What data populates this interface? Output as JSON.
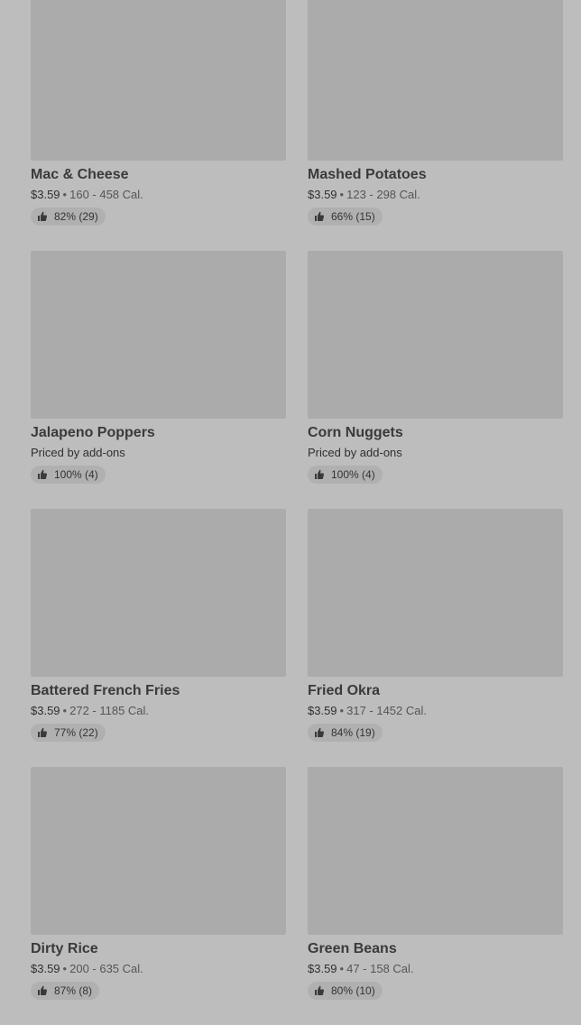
{
  "items": [
    {
      "name": "Mac & Cheese",
      "price": "$3.59",
      "separator": "•",
      "calories": "160 - 458 Cal.",
      "rating": "82% (29)",
      "icon": "thumbs-up-icon"
    },
    {
      "name": "Mashed Potatoes",
      "price": "$3.59",
      "separator": "•",
      "calories": "123 - 298 Cal.",
      "rating": "66% (15)",
      "icon": "thumbs-up-icon"
    },
    {
      "name": "Jalapeno Poppers",
      "price": "Priced by add-ons",
      "separator": "",
      "calories": "",
      "rating": "100% (4)",
      "icon": "thumbs-up-icon"
    },
    {
      "name": "Corn Nuggets",
      "price": "Priced by add-ons",
      "separator": "",
      "calories": "",
      "rating": "100% (4)",
      "icon": "thumbs-up-icon"
    },
    {
      "name": "Battered French Fries",
      "price": "$3.59",
      "separator": "•",
      "calories": "272 - 1185 Cal.",
      "rating": "77% (22)",
      "icon": "thumbs-up-icon"
    },
    {
      "name": "Fried Okra",
      "price": "$3.59",
      "separator": "•",
      "calories": "317 - 1452 Cal.",
      "rating": "84% (19)",
      "icon": "thumbs-up-icon"
    },
    {
      "name": "Dirty Rice",
      "price": "$3.59",
      "separator": "•",
      "calories": "200 - 635 Cal.",
      "rating": "87% (8)",
      "icon": "thumbs-up-icon"
    },
    {
      "name": "Green Beans",
      "price": "$3.59",
      "separator": "•",
      "calories": "47 - 158 Cal.",
      "rating": "80% (10)",
      "icon": "thumbs-up-icon"
    }
  ]
}
